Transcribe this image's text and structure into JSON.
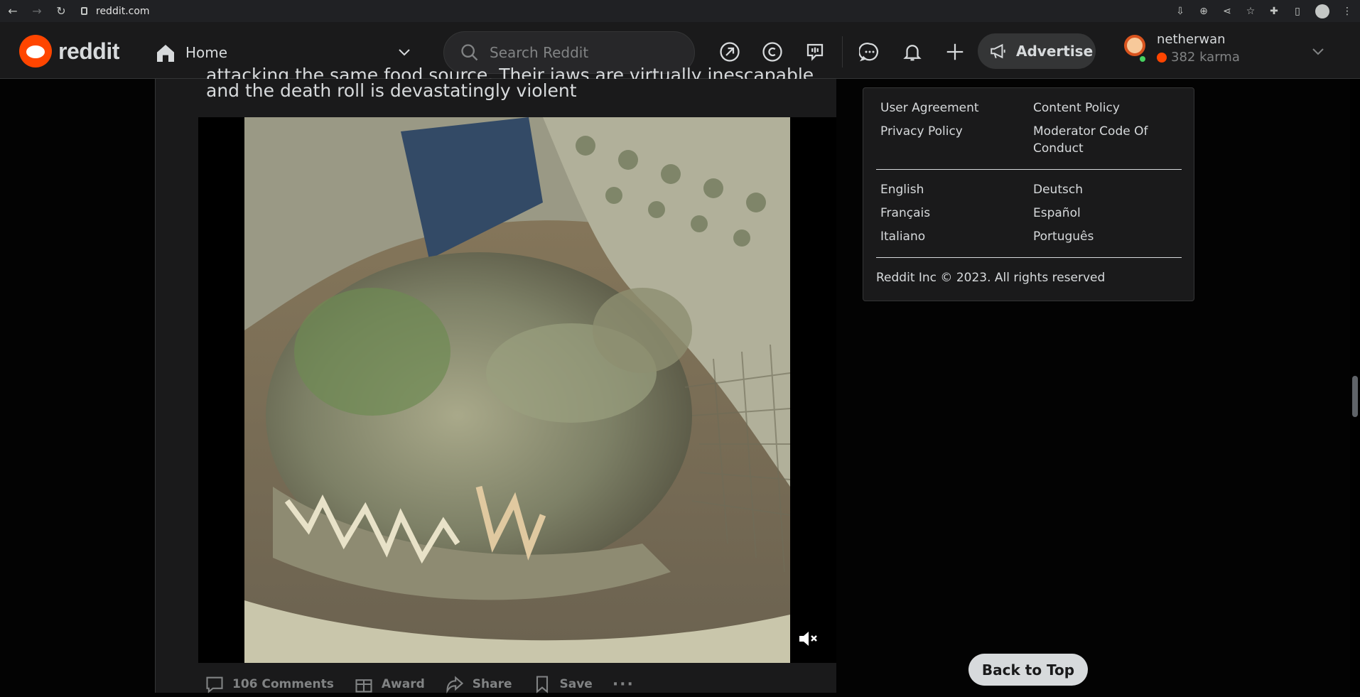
{
  "browser": {
    "url": "reddit.com",
    "icons": [
      "back-icon",
      "forward-icon",
      "reload-icon",
      "lock-icon",
      "install-icon",
      "zoom-icon",
      "share-icon",
      "star-icon",
      "extensions-icon",
      "sidepanel-icon",
      "account-icon",
      "menu-icon"
    ]
  },
  "header": {
    "logo_text": "reddit",
    "home_label": "Home",
    "search_placeholder": "Search Reddit",
    "advertise_label": "Advertise",
    "username": "netherwan",
    "karma": "382 karma",
    "icons": [
      "popular-icon",
      "coins-icon",
      "talk-icon",
      "chat-icon",
      "notifications-icon",
      "create-post-icon"
    ]
  },
  "post": {
    "title_partial": "attacking the same food source. Their jaws are virtually inescapable",
    "title_line2": "and the death roll is devastatingly violent",
    "media_alt": "crocodile video",
    "actions": {
      "comments": "106 Comments",
      "award": "Award",
      "share": "Share",
      "save": "Save",
      "more": "···"
    }
  },
  "sidebar": {
    "links": [
      "User Agreement",
      "Content Policy",
      "Privacy Policy",
      "Moderator Code Of Conduct"
    ],
    "languages": [
      "English",
      "Deutsch",
      "Français",
      "Español",
      "Italiano",
      "Português"
    ],
    "copyright": "Reddit Inc © 2023. All rights reserved"
  },
  "back_to_top": "Back to Top",
  "colors": {
    "accent": "#ff4500",
    "bg": "#030303",
    "surface": "#1a1a1b",
    "text": "#d7dadc",
    "muted": "#818384"
  }
}
